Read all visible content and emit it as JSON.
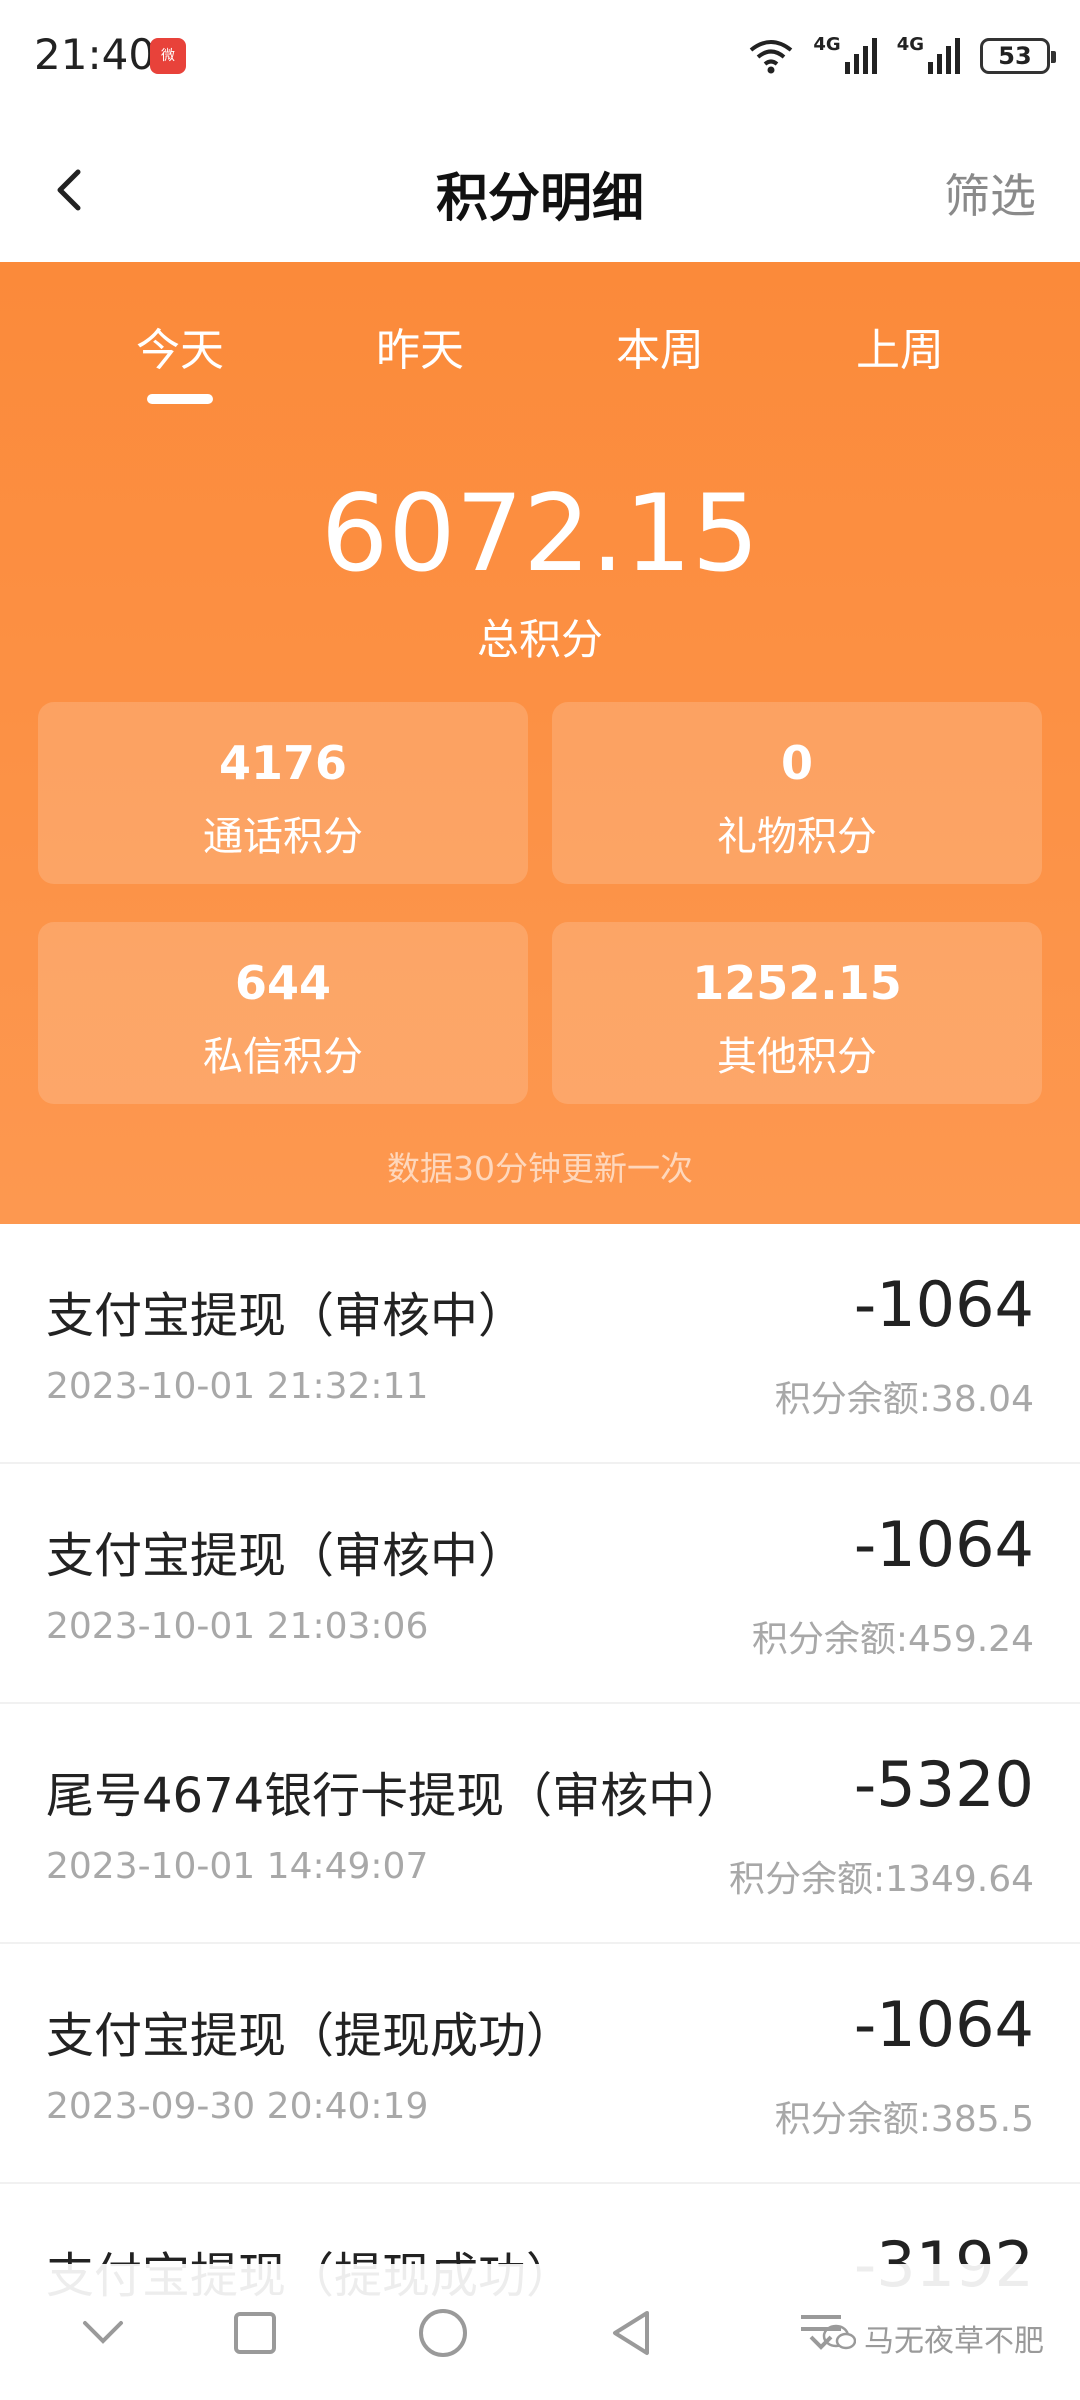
{
  "status": {
    "time": "21:40",
    "app_badge": "微",
    "network1": "4G",
    "network2": "4G",
    "battery": "53"
  },
  "header": {
    "title": "积分明细",
    "filter_label": "筛选"
  },
  "tabs": [
    {
      "label": "今天"
    },
    {
      "label": "昨天"
    },
    {
      "label": "本周"
    },
    {
      "label": "上周"
    }
  ],
  "summary": {
    "total_value": "6072.15",
    "total_label": "总积分",
    "cards": [
      {
        "value": "4176",
        "label": "通话积分"
      },
      {
        "value": "0",
        "label": "礼物积分"
      },
      {
        "value": "644",
        "label": "私信积分"
      },
      {
        "value": "1252.15",
        "label": "其他积分"
      }
    ],
    "update_note": "数据30分钟更新一次"
  },
  "records": [
    {
      "title": "支付宝提现（审核中）",
      "amount": "-1064",
      "time": "2023-10-01 21:32:11",
      "balance": "积分余额:38.04"
    },
    {
      "title": "支付宝提现（审核中）",
      "amount": "-1064",
      "time": "2023-10-01 21:03:06",
      "balance": "积分余额:459.24"
    },
    {
      "title": "尾号4674银行卡提现（审核中）",
      "amount": "-5320",
      "time": "2023-10-01 14:49:07",
      "balance": "积分余额:1349.64"
    },
    {
      "title": "支付宝提现（提现成功）",
      "amount": "-1064",
      "time": "2023-09-30 20:40:19",
      "balance": "积分余额:385.5"
    },
    {
      "title": "支付宝提现（提现成功）",
      "amount": "-3192"
    }
  ],
  "watermark": "马无夜草不肥",
  "colors": {
    "accent": "#fb8a3a",
    "accent_light": "#fd9850"
  }
}
